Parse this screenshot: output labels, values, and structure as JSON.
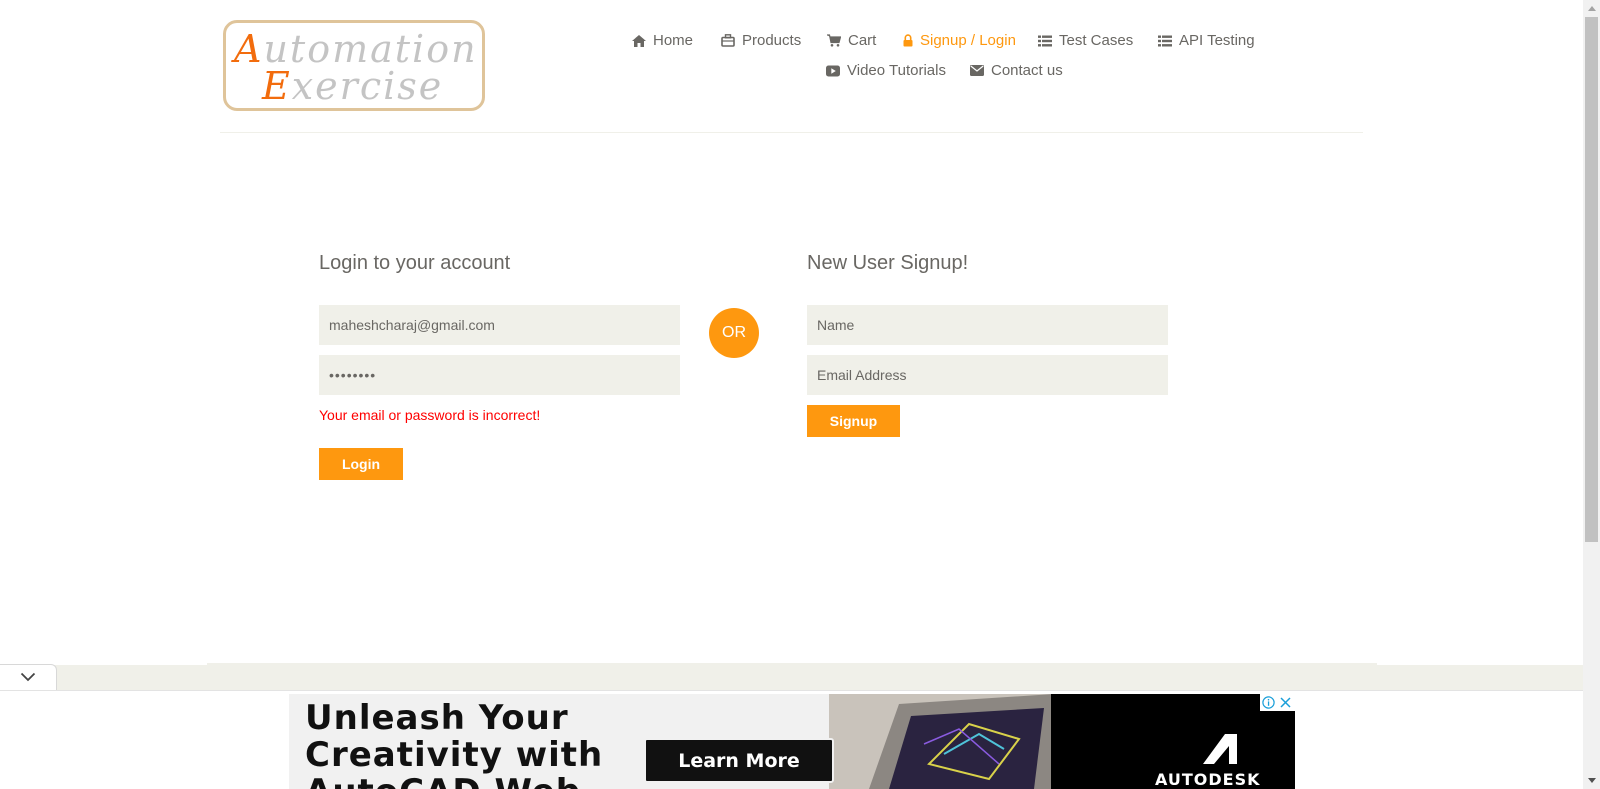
{
  "logo": {
    "line1_cap": "A",
    "line1_rest": "utomation",
    "line2_cap": "E",
    "line2_rest": "xercise"
  },
  "nav": {
    "items": [
      {
        "label": "Home",
        "icon": "home-icon"
      },
      {
        "label": "Products",
        "icon": "products-icon"
      },
      {
        "label": "Cart",
        "icon": "cart-icon"
      },
      {
        "label": "Signup / Login",
        "icon": "lock-icon",
        "active": true
      },
      {
        "label": "Test Cases",
        "icon": "list-icon"
      },
      {
        "label": "API Testing",
        "icon": "list-icon"
      },
      {
        "label": "Video Tutorials",
        "icon": "youtube-play-icon"
      },
      {
        "label": "Contact us",
        "icon": "envelope-icon"
      }
    ]
  },
  "login": {
    "title": "Login to your account",
    "email_value": "maheshcharaj@gmail.com",
    "password_value": "••••••••",
    "error": "Your email or password is incorrect!",
    "button": "Login"
  },
  "divider": {
    "label": "OR"
  },
  "signup": {
    "title": "New User Signup!",
    "name_placeholder": "Name",
    "email_placeholder": "Email Address",
    "button": "Signup"
  },
  "ad": {
    "headline": "Unleash Your\nCreativity with\nAutoCAD Web",
    "cta": "Learn More",
    "brand": "AUTODESK"
  },
  "colors": {
    "accent": "#fe980f",
    "text": "#696763",
    "field_bg": "#f0f0e9",
    "error": "#ff0000"
  }
}
